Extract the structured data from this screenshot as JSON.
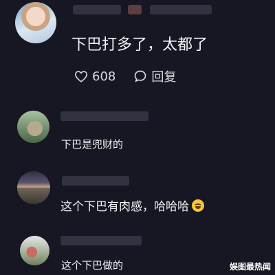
{
  "comments": [
    {
      "text": "下巴打多了，太都了",
      "likes": "608",
      "reply_label": "回复"
    },
    {
      "text": "下巴是兜财的"
    },
    {
      "text": "这个下巴有肉感，哈哈哈"
    },
    {
      "text": "这个下巴做的"
    }
  ],
  "watermark": "娱图最热闻",
  "icons": {
    "like": "heart-icon",
    "reply": "speech-bubble-icon",
    "laugh": "laughing-emoji-icon"
  },
  "colors": {
    "background": "#161722",
    "text": "#f2f2f5",
    "muted": "#d9d9de",
    "emoji": "#f7c63a"
  }
}
